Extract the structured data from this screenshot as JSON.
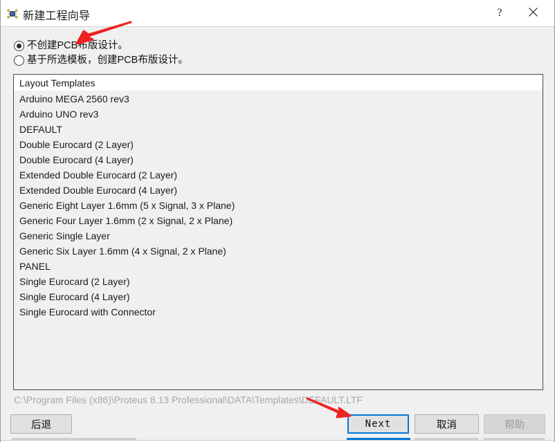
{
  "window": {
    "title": "新建工程向导",
    "icon": "proteus-chip-icon",
    "help_glyph": "?",
    "close_glyph": "✕"
  },
  "options": {
    "radio1": {
      "label": "不创建PCB布版设计。",
      "selected": true
    },
    "radio2": {
      "label": "基于所选模板，创建PCB布版设计。",
      "selected": false
    }
  },
  "list": {
    "header": "Layout Templates",
    "items": [
      "Arduino MEGA 2560 rev3",
      "Arduino UNO rev3",
      "DEFAULT",
      "Double Eurocard (2 Layer)",
      "Double Eurocard (4 Layer)",
      "Extended Double Eurocard (2 Layer)",
      "Extended Double Eurocard (4 Layer)",
      "Generic Eight Layer 1.6mm (5 x Signal, 3 x Plane)",
      "Generic Four Layer 1.6mm (2 x Signal, 2 x Plane)",
      "Generic Single Layer",
      "Generic Six Layer 1.6mm (4 x Signal, 2 x Plane)",
      "PANEL",
      "Single Eurocard (2 Layer)",
      "Single Eurocard (4 Layer)",
      "Single Eurocard with Connector"
    ]
  },
  "status": {
    "path": "C:\\Program Files (x86)\\Proteus 8.13 Professional\\DATA\\Templates\\DEFAULT.LTF"
  },
  "footer": {
    "back": "后退",
    "next": "Next",
    "cancel": "取消",
    "help": "帮助",
    "help_disabled": true,
    "next_focused": true
  },
  "annotations": {
    "arrow1_target": "不创建PCB布版设计 radio button",
    "arrow2_target": "Next button",
    "arrow_color": "#ee2222"
  },
  "colors": {
    "dialog_bg": "#f0f0f0",
    "titlebar_bg": "#ffffff",
    "list_header_bg": "#ffffff",
    "list_bg": "#f0f0f0",
    "focus_border": "#0078d7",
    "status_text": "#a6a6a6",
    "arrow_red": "#ee2222"
  }
}
